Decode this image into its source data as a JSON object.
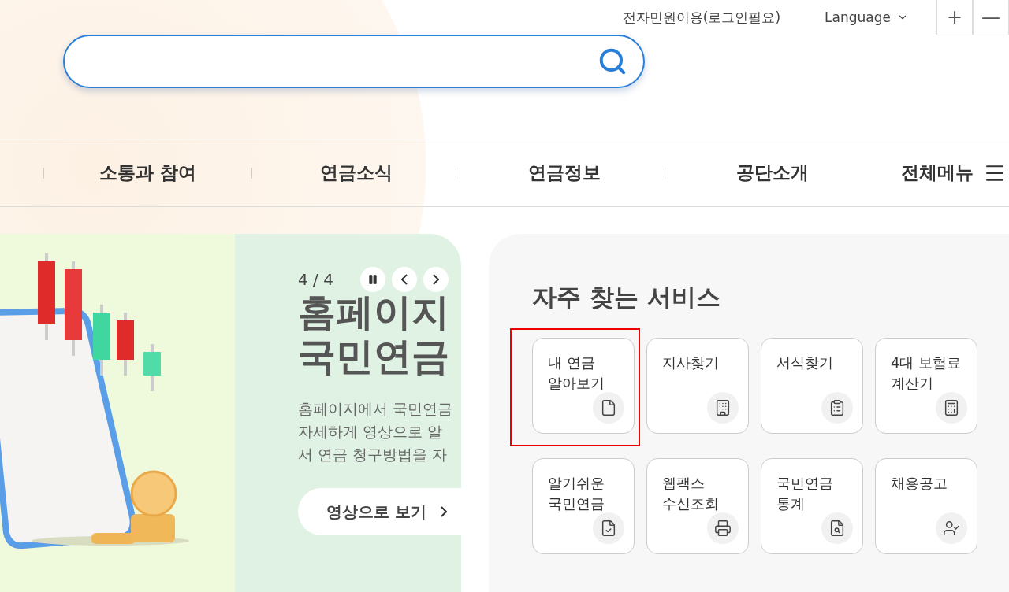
{
  "utility": {
    "link": "전자민원이용(로그인필요)",
    "language": "Language",
    "zoom_in": "+",
    "zoom_out": "—"
  },
  "nav": {
    "items": [
      "소통과 참여",
      "연금소식",
      "연금정보",
      "공단소개"
    ],
    "all_menu": "전체메뉴"
  },
  "hero": {
    "counter": "4 / 4",
    "paused": false,
    "title": [
      "홈페이지",
      "국민연금"
    ],
    "description": [
      "홈페이지에서 국민연금",
      "자세하게 영상으로 알",
      "서 연금 청구방법을 자"
    ],
    "button": "영상으로 보기"
  },
  "services": {
    "title": "자주 찾는 서비스",
    "items": [
      {
        "label": [
          "내 연금",
          "알아보기"
        ],
        "selected": true
      },
      {
        "label": [
          "지사찾기"
        ],
        "selected": false
      },
      {
        "label": [
          "서식찾기"
        ],
        "selected": false
      },
      {
        "label": [
          "4대 보험료",
          "계산기"
        ],
        "selected": false
      },
      {
        "label": [
          "알기쉬운",
          "국민연금"
        ],
        "selected": false
      },
      {
        "label": [
          "웹팩스",
          "수신조회"
        ],
        "selected": false
      },
      {
        "label": [
          "국민연금",
          "통계"
        ],
        "selected": false
      },
      {
        "label": [
          "채용공고"
        ],
        "selected": false
      }
    ]
  }
}
